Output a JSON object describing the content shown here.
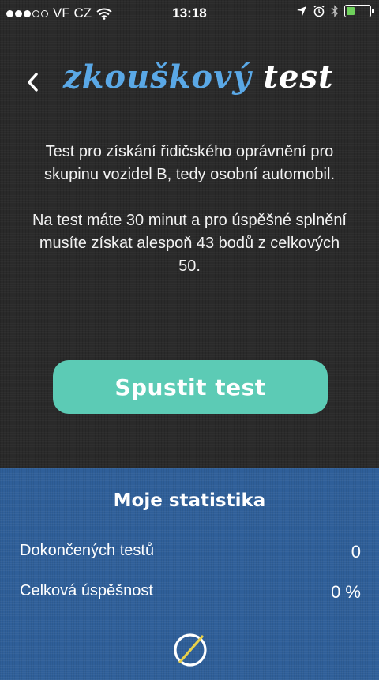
{
  "status_bar": {
    "carrier": "VF CZ",
    "time": "13:18"
  },
  "header": {
    "title_part1": "zkouškový",
    "title_part2": "test"
  },
  "description": {
    "paragraph1": "Test  pro získání řidičského oprávnění pro skupinu vozidel B, tedy osobní automobil.",
    "paragraph2": "Na test máte 30 minut a pro úspěšné splnění musíte získat alespoň 43 bodů z celkových 50."
  },
  "start_button": {
    "label": "Spustit test"
  },
  "stats": {
    "title": "Moje statistika",
    "completed_label": "Dokončených testů",
    "completed_value": "0",
    "success_label": "Celková úspěšnost",
    "success_value": "0 %"
  },
  "colors": {
    "accent_blue": "#5aa8e6",
    "button_teal": "#5ccbb5",
    "stats_bg": "#2f5f99",
    "logo_yellow": "#e8d04a"
  },
  "icons": {
    "back": "chevron-left-icon",
    "wifi": "wifi-icon",
    "location": "location-arrow-icon",
    "alarm": "alarm-clock-icon",
    "bluetooth": "bluetooth-icon",
    "battery": "battery-icon",
    "logo": "app-logo-icon"
  }
}
